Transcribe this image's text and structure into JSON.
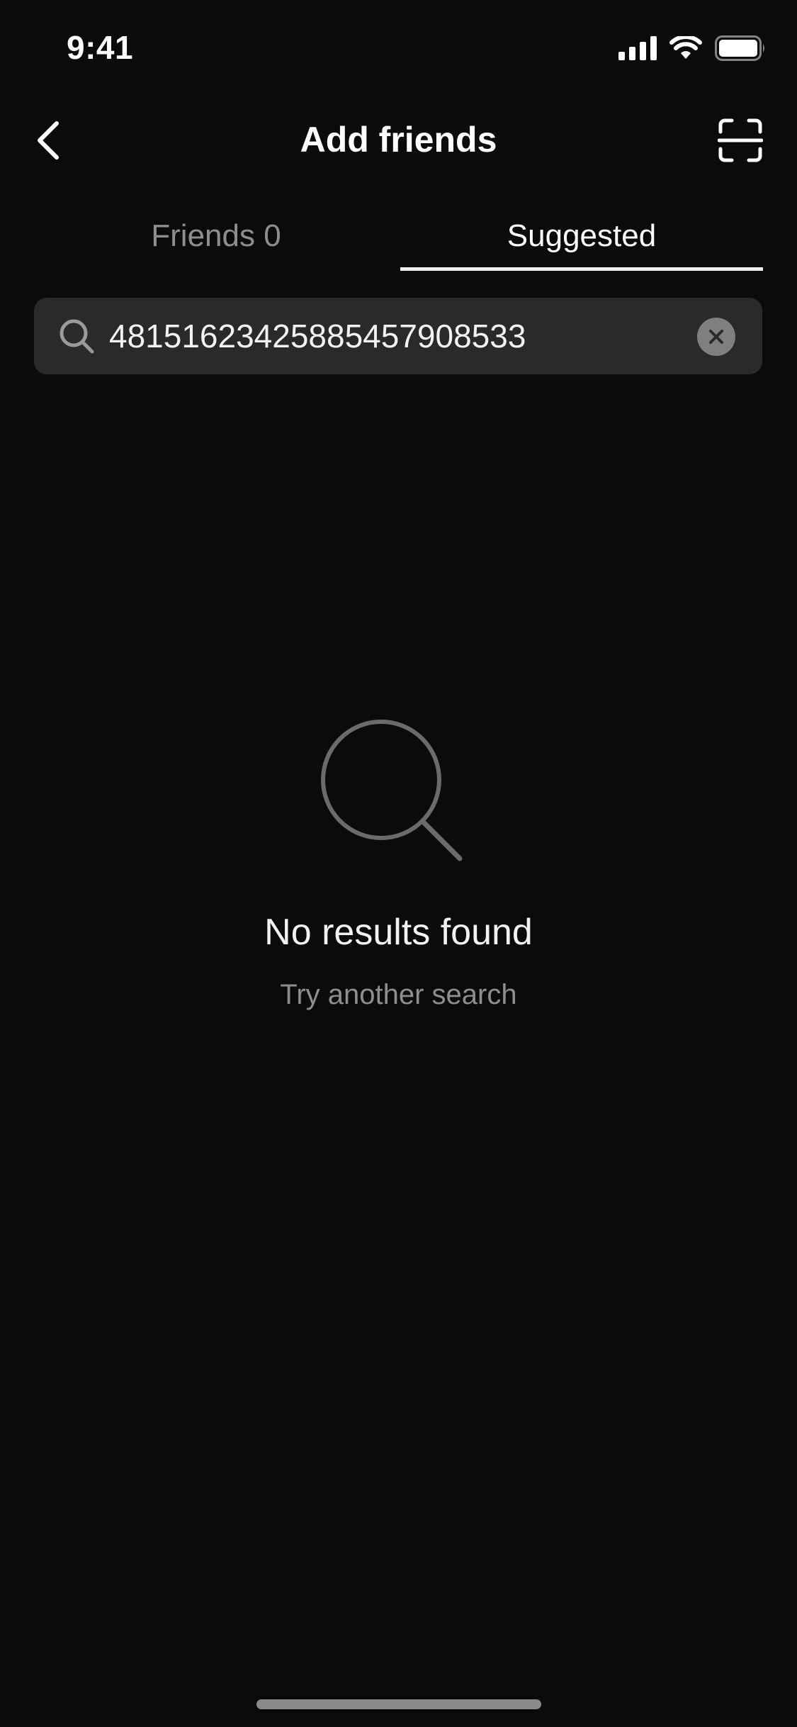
{
  "status_bar": {
    "time": "9:41"
  },
  "header": {
    "title": "Add friends",
    "back_icon": "chevron-left-icon",
    "scan_icon": "scan-icon"
  },
  "tabs": [
    {
      "label": "Friends 0",
      "selected": false
    },
    {
      "label": "Suggested",
      "selected": true
    }
  ],
  "search": {
    "value": "48151623425885457908533",
    "placeholder": ""
  },
  "empty_state": {
    "title": "No results found",
    "subtitle": "Try another search"
  },
  "colors": {
    "background": "#0b0b0b",
    "search_bg": "#2a2a2a",
    "muted_text": "#8e8e8e",
    "primary_text": "#ffffff"
  }
}
